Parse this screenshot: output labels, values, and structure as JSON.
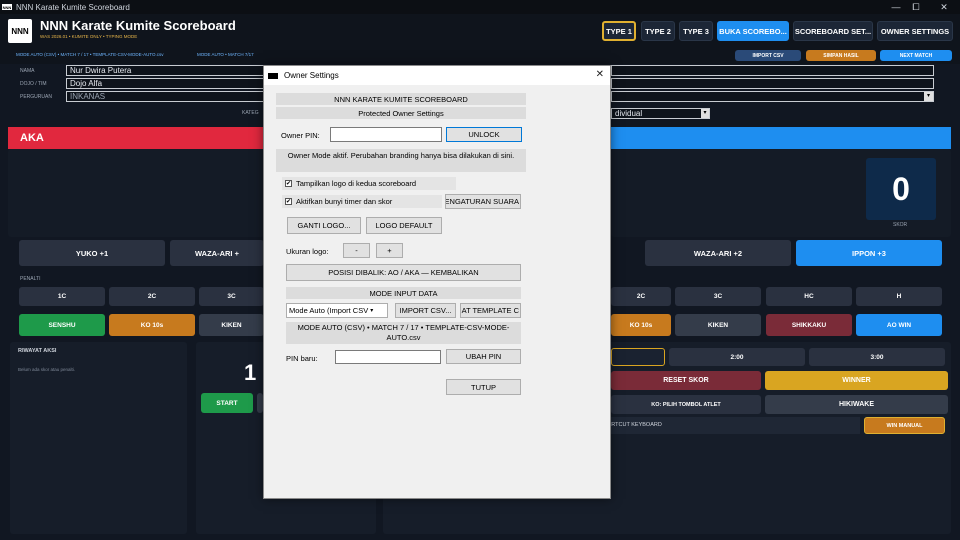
{
  "window": {
    "title": "NNN Karate Kumite Scoreboard",
    "min": "—",
    "max": "⧠",
    "close": "✕"
  },
  "app": {
    "logo": "NNN",
    "title": "NNN Karate Kumite Scoreboard",
    "subtitle": "WAS 2026.01 • KUMITE ONLY • TYPING MODE",
    "nav": [
      "TYPE 1",
      "TYPE 2",
      "TYPE 3",
      "BUKA SCOREBO...",
      "SCOREBOARD SET...",
      "OWNER SETTINGS"
    ]
  },
  "infobar": {
    "left": "MODE AUTO (CSV) • MATCH 7 / 17 • TEMPLATE-CSV-MODE-AUTO.csv",
    "middle": "MODE AUTO • MATCH 7/17",
    "import": "IMPORT CSV",
    "save": "SIMPAN HASIL",
    "next": "NEXT MATCH"
  },
  "form": {
    "nama_label": "NAMA",
    "nama": "Nur Dwira Putera",
    "dojo_label": "DOJO / TIM",
    "dojo": "Dojo Alfa",
    "perguruan_label": "PERGURUAN",
    "perguruan": "INKANAS",
    "kategori_label": "KATEG",
    "kategori": "dividual"
  },
  "aka": {
    "label": "AKA",
    "yuko": "YUKO +1",
    "waza": "WAZA-ARI +",
    "penalti_label": "PENALTI",
    "penalties": [
      "1C",
      "2C",
      "3C"
    ],
    "senshu": "SENSHU",
    "ko": "KO 10s",
    "kiken": "KIKEN"
  },
  "ao": {
    "score": "0",
    "score_label": "SKOR",
    "waza": "WAZA-ARI +2",
    "ippon": "IPPON +3",
    "penalties": [
      "2C",
      "3C",
      "HC",
      "H"
    ],
    "ko": "KO 10s",
    "kiken": "KIKEN",
    "shikkaku": "SHIKKAKU",
    "aowin": "AO WIN"
  },
  "riwayat": {
    "title": "RIWAYAT AKSI",
    "empty": "Belum ada skor atau penalti."
  },
  "timer": {
    "digit": "1",
    "start": "START"
  },
  "controls": {
    "t2": "2:00",
    "t3": "3:00",
    "reset": "RESET SKOR",
    "winner": "WINNER",
    "ko_hint": "KO: PILIH TOMBOL ATLET",
    "hikiwake": "HIKIWAKE",
    "shortcut": "ORTCUT KEYBOARD",
    "winmanual": "WIN MANUAL"
  },
  "colors": {
    "aka": "#e1283e",
    "ao": "#1e8ef0",
    "gold": "#d9a521",
    "orange": "#c77a1e",
    "green": "#1e9a4a"
  },
  "dialog": {
    "title": "Owner Settings",
    "header": "NNN KARATE KUMITE SCOREBOARD",
    "subheader": "Protected Owner Settings",
    "pin_label": "Owner PIN:",
    "unlock": "UNLOCK",
    "notice": "Owner Mode aktif. Perubahan branding hanya bisa dilakukan di sini.",
    "chk_logo": "Tampilkan logo di kedua scoreboard",
    "chk_sound": "Aktifkan bunyi timer dan skor",
    "sound_btn": "ENGATURAN SUARA",
    "ganti_logo": "GANTI LOGO...",
    "logo_default": "LOGO DEFAULT",
    "ukuran_label": "Ukuran logo:",
    "minus": "-",
    "plus": "+",
    "posisi": "POSISI DIBALIK: AO / AKA — KEMBALIKAN",
    "mode_header": "MODE INPUT DATA",
    "mode_select": "Mode Auto (Import CSV",
    "import_csv": "IMPORT CSV...",
    "template_btn": "AT TEMPLATE C",
    "mode_status": "MODE AUTO (CSV) • MATCH 7 / 17 • TEMPLATE-CSV-MODE-AUTO.csv",
    "pin_baru_label": "PIN baru:",
    "ubah_pin": "UBAH PIN",
    "tutup": "TUTUP"
  }
}
